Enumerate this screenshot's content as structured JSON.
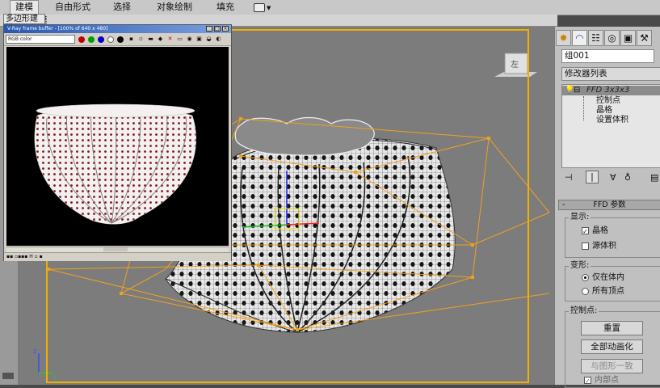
{
  "ribbon": {
    "tabs": [
      "建模",
      "自由形式",
      "选择",
      "对象绘制",
      "填充"
    ],
    "active_tab": "建模",
    "dropdown_icon": "menu-dropdown-icon"
  },
  "subbar": {
    "label": "多边形建模"
  },
  "viewport": {
    "frame_color": "#f0b000",
    "lattice_color": "#f0a020",
    "viewcube_label": "左"
  },
  "vray": {
    "title": "V-Ray frame buffer - [100% of 640 x 480]",
    "channel": "RGB color",
    "toolbar_colors": [
      "#c00000",
      "#00a000",
      "#0000c0",
      "#ffffff",
      "#000000"
    ]
  },
  "panel": {
    "object_name": "组001",
    "modifier_list": "修改器列表",
    "stack": {
      "modifier": "FFD 3x3x3",
      "subitems": [
        "控制点",
        "晶格",
        "设置体积"
      ]
    },
    "rollout_title": "FFD 参数",
    "display": {
      "label": "显示:",
      "lattice": {
        "label": "晶格",
        "checked": true
      },
      "source_volume": {
        "label": "源体积",
        "checked": false
      }
    },
    "deform": {
      "label": "变形:",
      "in_volume": {
        "label": "仅在体内",
        "selected": true
      },
      "all_vertices": {
        "label": "所有顶点",
        "selected": false
      }
    },
    "control_points": {
      "label": "控制点:",
      "reset": "重置",
      "animate_all": "全部动画化",
      "conform": "与图形一致",
      "inner_points": {
        "label": "内部点",
        "checked": true
      }
    }
  }
}
